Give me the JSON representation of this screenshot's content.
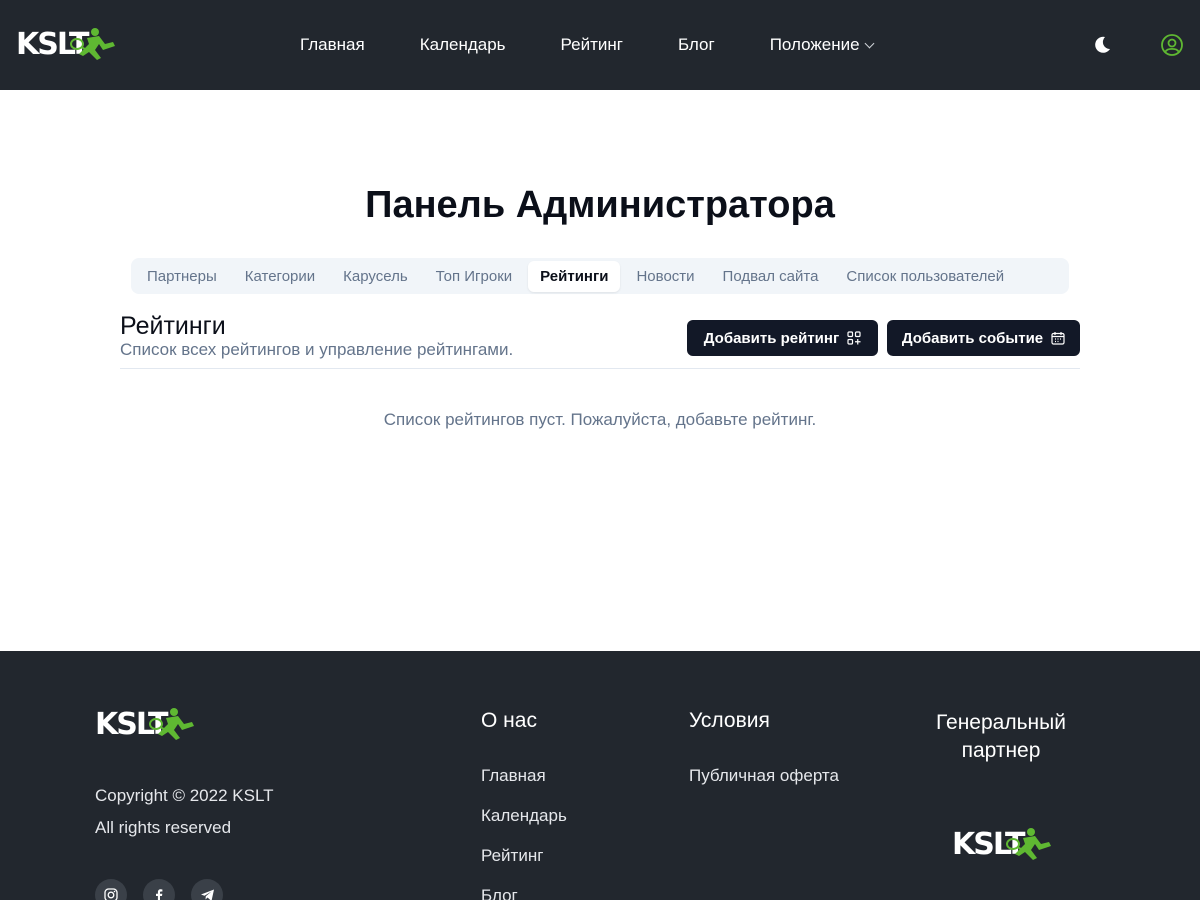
{
  "header": {
    "logo_text": "KSLT",
    "nav": [
      {
        "label": "Главная"
      },
      {
        "label": "Календарь"
      },
      {
        "label": "Рейтинг"
      },
      {
        "label": "Блог"
      },
      {
        "label": "Положение"
      }
    ],
    "icons": {
      "theme": "moon-icon",
      "account": "user-circle-icon"
    }
  },
  "main": {
    "title": "Панель Администратора",
    "tabs": [
      {
        "label": "Партнеры"
      },
      {
        "label": "Категории"
      },
      {
        "label": "Карусель"
      },
      {
        "label": "Топ Игроки"
      },
      {
        "label": "Рейтинги",
        "active": true
      },
      {
        "label": "Новости"
      },
      {
        "label": "Подвал сайта"
      },
      {
        "label": "Список пользователей"
      }
    ],
    "section_title": "Рейтинги",
    "section_subtitle": "Список всех рейтингов и управление рейтингами.",
    "add_rating_label": "Добавить рейтинг",
    "add_event_label": "Добавить событие",
    "empty_message": "Список рейтингов пуст. Пожалуйста, добавьте рейтинг."
  },
  "footer": {
    "logo_text": "KSLT",
    "copyright": "Copyright © 2022 KSLT",
    "rights": "All rights reserved",
    "social": [
      "instagram-icon",
      "facebook-icon",
      "telegram-icon"
    ],
    "about_title": "О нас",
    "about_links": [
      "Главная",
      "Календарь",
      "Рейтинг",
      "Блог"
    ],
    "terms_title": "Условия",
    "terms_links": [
      "Публичная оферта"
    ],
    "partner_title": "Генеральный партнер",
    "partner_logo_text": "KSLT"
  },
  "colors": {
    "header_bg": "#22272e",
    "accent_green": "#5fb832",
    "button_bg": "#121827",
    "tab_bg": "#f1f5f9"
  }
}
